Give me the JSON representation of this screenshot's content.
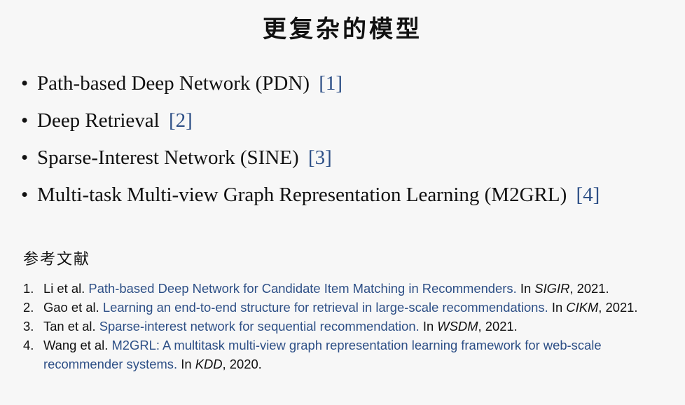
{
  "title": "更复杂的模型",
  "bullet_symbol": "•",
  "bullets": [
    {
      "text": "Path-based Deep Network (PDN)",
      "ref": "[1]"
    },
    {
      "text": "Deep Retrieval",
      "ref": "[2]"
    },
    {
      "text": "Sparse-Interest Network (SINE)",
      "ref": "[3]"
    },
    {
      "text": "Multi-task Multi-view Graph Representation Learning (M2GRL)",
      "ref": "[4]"
    }
  ],
  "references_heading": "参考文献",
  "references": [
    {
      "num": "1.",
      "authors": "Li et al.",
      "paper": "Path-based Deep Network for Candidate Item Matching in Recommenders.",
      "in": "In",
      "venue": "SIGIR",
      "year": ", 2021."
    },
    {
      "num": "2.",
      "authors": "Gao et al.",
      "paper": "Learning an end-to-end structure for retrieval in large-scale recommendations.",
      "in": "In",
      "venue": "CIKM",
      "year": ", 2021."
    },
    {
      "num": "3.",
      "authors": "Tan et al.",
      "paper": "Sparse-interest network for sequential recommendation.",
      "in": "In",
      "venue": "WSDM",
      "year": ", 2021."
    },
    {
      "num": "4.",
      "authors": "Wang et al.",
      "paper": "M2GRL: A multitask multi-view graph representation learning framework for web-scale recommender systems.",
      "in": "In",
      "venue": "KDD",
      "year": ", 2020."
    }
  ],
  "colors": {
    "link": "#2d4f86",
    "text": "#111111",
    "background": "#f7f7f7"
  }
}
